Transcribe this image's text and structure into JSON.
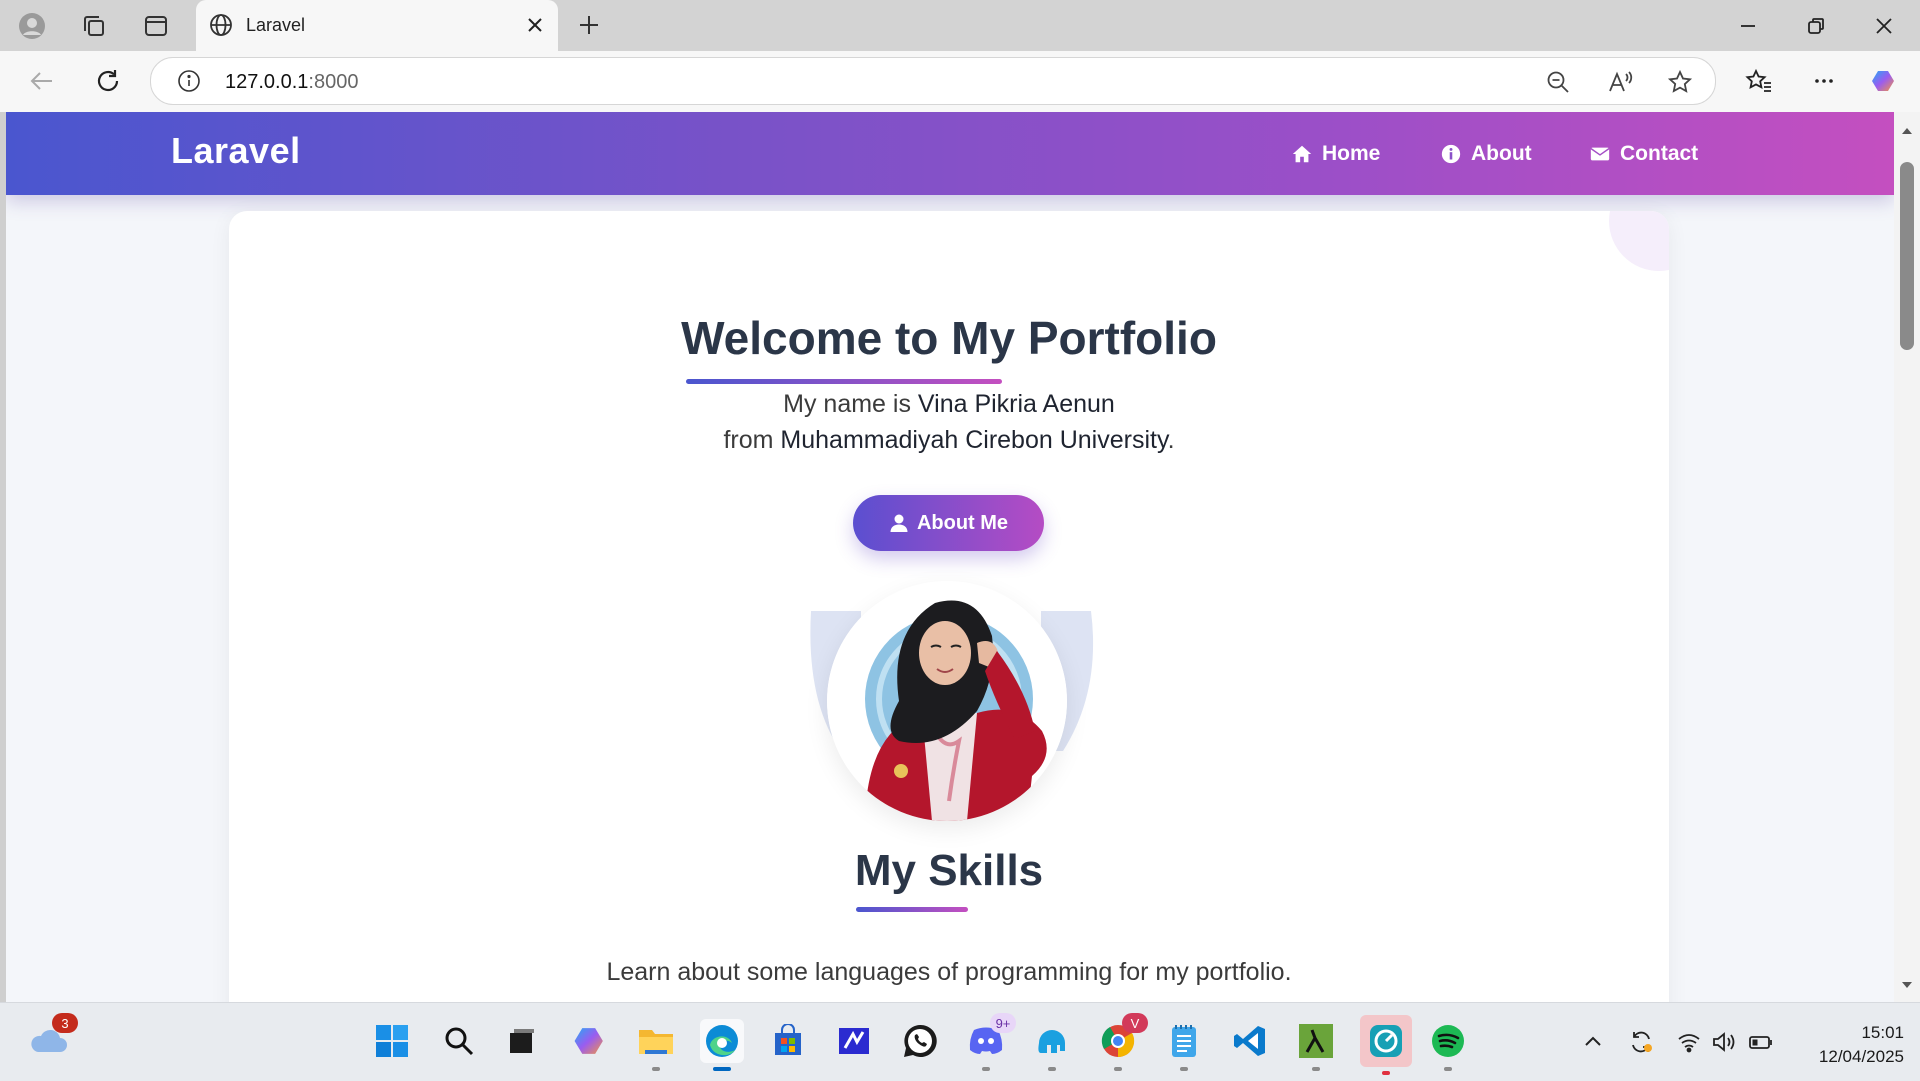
{
  "browser": {
    "tab_title": "Laravel",
    "url_host": "127.0.0.1",
    "url_port": ":8000"
  },
  "site": {
    "brand": "Laravel",
    "nav": [
      {
        "label": "Home",
        "icon": "home-icon"
      },
      {
        "label": "About",
        "icon": "info-icon"
      },
      {
        "label": "Contact",
        "icon": "envelope-icon"
      }
    ]
  },
  "hero": {
    "title": "Welcome to My Portfolio",
    "line1_pre": "My name is ",
    "name": "Vina Pikria Aenun",
    "line2_pre": "from ",
    "university": "Muhammadiyah Cirebon University",
    "line2_post": ".",
    "button_label": "About Me"
  },
  "skills": {
    "title": "My Skills",
    "description": "Learn about some languages of programming for my portfolio."
  },
  "taskbar": {
    "weather_badge": "3",
    "discord_badge": "9+",
    "chrome_badge": "V",
    "time": "15:01",
    "date": "12/04/2025"
  },
  "colors": {
    "nav_gradient_start": "#4a56cf",
    "nav_gradient_end": "#c44fc0",
    "heading": "#2b3648"
  }
}
